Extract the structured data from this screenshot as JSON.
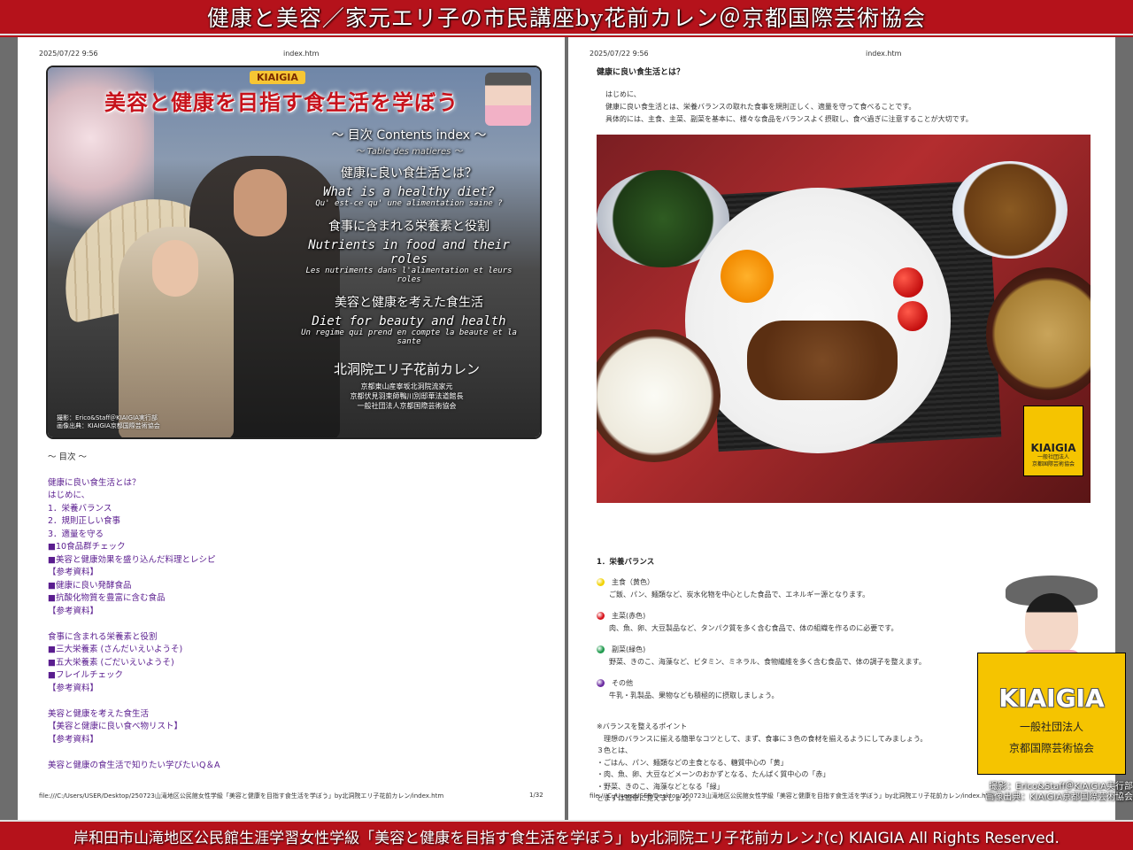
{
  "banner_top": "健康と美容／家元エリ子の市民講座by花前カレン＠京都国際芸術協会",
  "banner_bottom": "岸和田市山滝地区公民館生涯学習女性学級「美容と健康を目指す食生活を学ぼう」by北洞院エリ子花前カレン♪(c) KIAIGIA All Rights Reserved.",
  "left_page": {
    "date": "2025/07/22 9:56",
    "filename": "index.htm",
    "hero": {
      "tag": "KIAIGIA",
      "title": "美容と健康を目指す食生活を学ぼう",
      "toc_title": "～ 目次 Contents index ～",
      "toc_subtitle": "～ Table des matieres ～",
      "sections": [
        {
          "jp": "健康に良い食生活とは？",
          "en": "What is a healthy diet?",
          "fr": "Qu' est-ce qu' une alimentation saine ?"
        },
        {
          "jp": "食事に含まれる栄養素と役割",
          "en": "Nutrients in food and their roles",
          "fr": "Les nutriments dans l'alimentation et leurs roles"
        },
        {
          "jp": "美容と健康を考えた食生活",
          "en": "Diet for beauty and health",
          "fr": "Un regime qui prend en compte la beaute et la sante"
        }
      ],
      "signature": "北洞院エリ子花前カレン",
      "sig_lines": [
        "京都東山産寧坂北洞院流家元",
        "京都伏見羽束師鴨川別邸華法道館長",
        "一般社団法人京都国際芸術協会"
      ],
      "credit": [
        "撮影：Erico&Staff＠KIAIGIA実行部",
        "画像出典：KIAIGIA京都国際芸術協会"
      ]
    },
    "toc_heading": "～ 目次 ～",
    "toc_blocks": [
      [
        "健康に良い食生活とは？",
        "はじめに、",
        "1．栄養バランス",
        "2．規則正しい食事",
        "3．適量を守る",
        "■10食品群チェック",
        "■美容と健康効果を盛り込んだ料理とレシピ",
        "【参考資料】",
        "■健康に良い発酵食品",
        "■抗酸化物質を豊富に含む食品",
        "【参考資料】"
      ],
      [
        "食事に含まれる栄養素と役割",
        "■三大栄養素 (さんだいえいようそ)",
        "■五大栄養素 (ごだいえいようそ)",
        "■フレイルチェック",
        "【参考資料】"
      ],
      [
        "美容と健康を考えた食生活",
        "【美容と健康に良い食べ物リスト】",
        "【参考資料】"
      ],
      [
        "美容と健康の食生活で知りたい学びたいQ＆A"
      ]
    ],
    "footer_path": "file:///C:/Users/USER/Desktop/250723山滝地区公民館女性学級「美容と健康を目指す食生活を学ぼう」by北洞院エリ子花前カレン/index.htm",
    "page_num": "1/32"
  },
  "right_page": {
    "date": "2025/07/22 9:56",
    "filename": "index.htm",
    "title": "健康に良い食生活とは？",
    "intro": [
      "はじめに、",
      "健康に良い食生活とは、栄養バランスの取れた食事を規則正しく、適量を守って食べることです。",
      "具体的には、主食、主菜、副菜を基本に、様々な食品をバランスよく摂取し、食べ過ぎに注意することが大切です。"
    ],
    "photo_badge": {
      "name": "KIAIGIA",
      "sub1": "一般社団法人",
      "sub2": "京都国際芸術協会"
    },
    "section": "1．栄養バランス",
    "groups": [
      {
        "color": "#f2d200",
        "title": "主食（黄色）",
        "desc": "ご飯、パン、麺類など、炭水化物を中心とした食品で、エネルギー源となります。"
      },
      {
        "color": "#d8141c",
        "title": "主菜(赤色)",
        "desc": "肉、魚、卵、大豆製品など、タンパク質を多く含む食品で、体の組織を作るのに必要です。"
      },
      {
        "color": "#1f9a4d",
        "title": "副菜(緑色)",
        "desc": "野菜、きのこ、海藻など、ビタミン、ミネラル、食物繊維を多く含む食品で、体の調子を整えます。"
      },
      {
        "color": "#6a2aa0",
        "title": "その他",
        "desc": "牛乳・乳製品、果物なども積極的に摂取しましょう。"
      }
    ],
    "tips": [
      "※バランスを整えるポイント",
      "　理想のバランスに揃える簡単なコツとして、まず、食事に３色の食材を揃えるようにしてみましょう。",
      "３色とは、",
      "・ごはん、パン、麺類などの主食となる、糖質中心の「黄」",
      "・肉、魚、卵、大豆などメーンのおかずとなる、たんぱく質中心の「赤」",
      "・野菜、きのこ、海藻などとなる「緑」",
      "とまずは簡単に覚えましょう。"
    ],
    "footer_path": "file:///C:/Users/USER/Desktop/250723山滝地区公民館女性学級「美容と健康を目指す食生活を学ぼう」by北洞院エリ子花前カレン/index.htm"
  },
  "overlay": {
    "name": "KIAIGIA",
    "sub1": "一般社団法人",
    "sub2": "京都国際芸術協会",
    "credit1": "撮影：Erico&Staff＠KIAIGIA実行部",
    "credit2": "画像出典：KIAIGIA京都国際芸術協会"
  }
}
